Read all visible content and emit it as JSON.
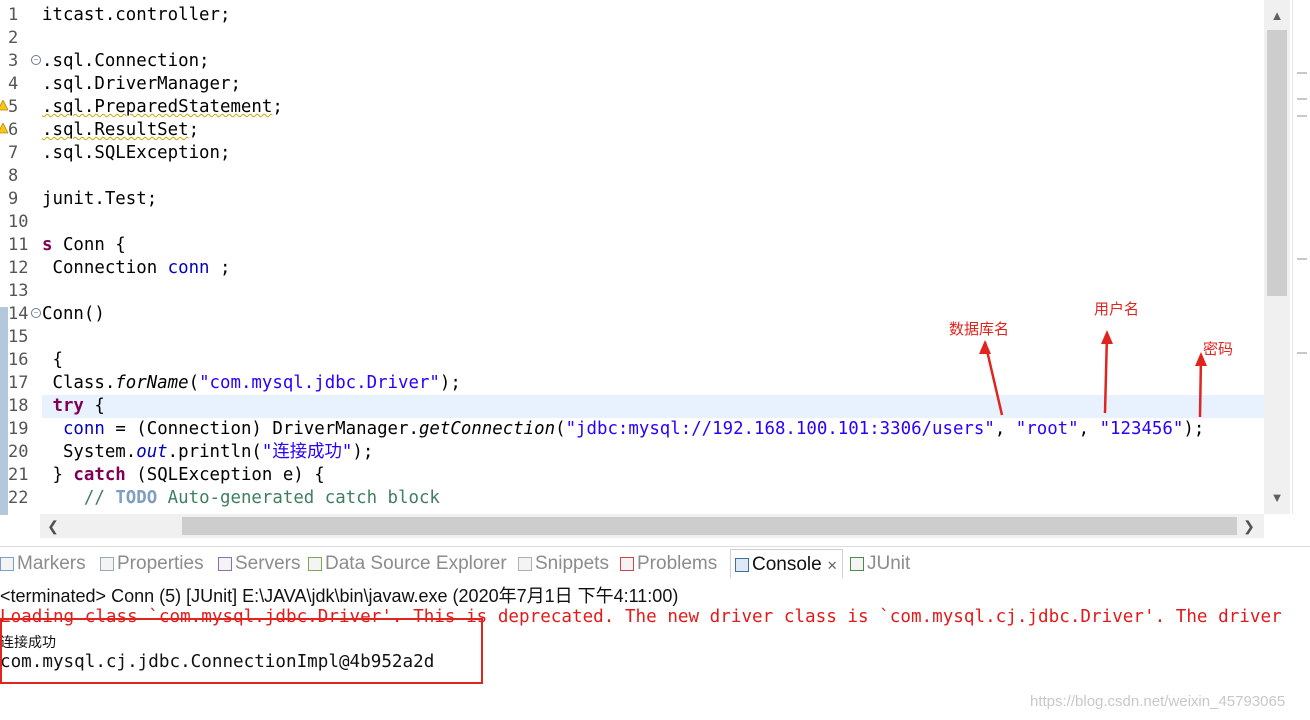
{
  "editor": {
    "lines": [
      {
        "n": "1",
        "parts": [
          [
            "",
            "itcast.controller;"
          ]
        ]
      },
      {
        "n": "2",
        "parts": []
      },
      {
        "n": "3",
        "fold": true,
        "parts": [
          [
            "",
            ".sql.Connection;"
          ]
        ]
      },
      {
        "n": "4",
        "parts": [
          [
            "",
            ".sql.DriverManager;"
          ]
        ]
      },
      {
        "n": "5",
        "warn": true,
        "parts": [
          [
            "warn-ul",
            ".sql.PreparedStatement"
          ],
          [
            "",
            ";"
          ]
        ]
      },
      {
        "n": "6",
        "warn": true,
        "parts": [
          [
            "warn-ul",
            ".sql.ResultSet"
          ],
          [
            "",
            ";"
          ]
        ]
      },
      {
        "n": "7",
        "parts": [
          [
            "",
            ".sql.SQLException;"
          ]
        ]
      },
      {
        "n": "8",
        "parts": []
      },
      {
        "n": "9",
        "parts": [
          [
            "",
            "junit.Test;"
          ]
        ]
      },
      {
        "n": "10",
        "parts": []
      },
      {
        "n": "11",
        "parts": [
          [
            "kw",
            "s"
          ],
          [
            "",
            " Conn {"
          ]
        ]
      },
      {
        "n": "12",
        "parts": [
          [
            "",
            " Connection "
          ],
          [
            "fld",
            "conn"
          ],
          [
            "",
            " ;"
          ]
        ]
      },
      {
        "n": "13",
        "parts": []
      },
      {
        "n": "14",
        "fold": true,
        "parts": [
          [
            "",
            "Conn()"
          ]
        ]
      },
      {
        "n": "15",
        "parts": []
      },
      {
        "n": "16",
        "parts": [
          [
            "",
            " {"
          ]
        ]
      },
      {
        "n": "17",
        "parts": [
          [
            "",
            " Class."
          ],
          [
            "itl",
            "forName"
          ],
          [
            "",
            "("
          ],
          [
            "str",
            "\"com.mysql.jdbc.Driver\""
          ],
          [
            "",
            ");"
          ]
        ]
      },
      {
        "n": "18",
        "parts": [
          [
            "",
            " "
          ],
          [
            "kw",
            "try"
          ],
          [
            "",
            " {"
          ]
        ]
      },
      {
        "n": "19",
        "parts": [
          [
            "",
            "  "
          ],
          [
            "fld",
            "conn"
          ],
          [
            "",
            " = (Connection) DriverManager."
          ],
          [
            "itl",
            "getConnection"
          ],
          [
            "",
            "("
          ],
          [
            "str",
            "\"jdbc:mysql://192.168.100.101:3306/users\""
          ],
          [
            "",
            ", "
          ],
          [
            "str",
            "\"root\""
          ],
          [
            "",
            ", "
          ],
          [
            "str",
            "\"123456\""
          ],
          [
            "",
            ");"
          ]
        ]
      },
      {
        "n": "20",
        "parts": [
          [
            "",
            "  System."
          ],
          [
            "fld itl",
            "out"
          ],
          [
            "",
            ".println("
          ],
          [
            "str",
            "\"连接成功\""
          ],
          [
            "",
            ");"
          ]
        ]
      },
      {
        "n": "21",
        "parts": [
          [
            "",
            " } "
          ],
          [
            "kw",
            "catch"
          ],
          [
            "",
            " (SQLException e) {"
          ]
        ]
      },
      {
        "n": "22",
        "parts": [
          [
            "",
            "    "
          ],
          [
            "cmt",
            "// "
          ],
          [
            "todo",
            "TODO"
          ],
          [
            "cmt",
            " Auto-generated catch block"
          ]
        ]
      }
    ]
  },
  "annotations": {
    "db_name": "数据库名",
    "username": "用户名",
    "password": "密码"
  },
  "tabs": [
    {
      "label": "Markers",
      "active": false
    },
    {
      "label": "Properties",
      "active": false
    },
    {
      "label": "Servers",
      "active": false
    },
    {
      "label": "Data Source Explorer",
      "active": false
    },
    {
      "label": "Snippets",
      "active": false
    },
    {
      "label": "Problems",
      "active": false
    },
    {
      "label": "Console",
      "active": true
    },
    {
      "label": "JUnit",
      "active": false
    }
  ],
  "console": {
    "terminated": "<terminated> Conn (5) [JUnit] E:\\JAVA\\jdk\\bin\\javaw.exe (2020年7月1日 下午4:11:00)",
    "error": "Loading class `com.mysql.jdbc.Driver'. This is deprecated. The new driver class is `com.mysql.cj.jdbc.Driver'. The driver",
    "out1": "连接成功",
    "out2": "com.mysql.cj.jdbc.ConnectionImpl@4b952a2d"
  },
  "watermark": "https://blog.csdn.net/weixin_45793065",
  "colors": {
    "keyword": "#7f0055",
    "string": "#2a00ff",
    "field": "#0000c0",
    "comment": "#3f7f5f",
    "annotation_red": "#e0241e",
    "console_error": "#e21a1a"
  }
}
